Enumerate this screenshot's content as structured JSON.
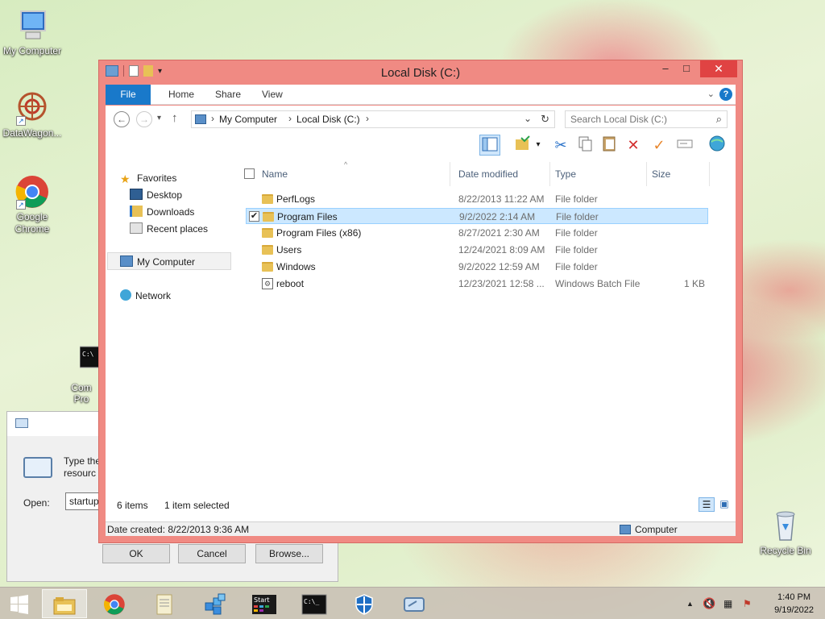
{
  "desktop": {
    "icons": [
      {
        "label": "My Computer"
      },
      {
        "label": "DataWagon..."
      },
      {
        "label": "Google Chrome"
      },
      {
        "label": "Com Pro"
      },
      {
        "label": "Recycle Bin"
      }
    ]
  },
  "run_dialog": {
    "description": "Type the\nresourc",
    "open_label": "Open:",
    "open_value": "startup",
    "ok_label": "OK",
    "cancel_label": "Cancel",
    "browse_label": "Browse..."
  },
  "explorer": {
    "title": "Local Disk (C:)",
    "minimize": "–",
    "maximize": "□",
    "close": "✕",
    "tabs": [
      "File",
      "Home",
      "Share",
      "View"
    ],
    "breadcrumb": [
      "My Computer",
      "Local Disk (C:)"
    ],
    "search_placeholder": "Search Local Disk (C:)",
    "nav": {
      "favorites": "Favorites",
      "favorites_items": [
        "Desktop",
        "Downloads",
        "Recent places"
      ],
      "my_computer": "My Computer",
      "network": "Network"
    },
    "columns": [
      "Name",
      "Date modified",
      "Type",
      "Size"
    ],
    "files": [
      {
        "name": "PerfLogs",
        "date": "8/22/2013 11:22 AM",
        "type": "File folder",
        "size": "",
        "kind": "folder",
        "selected": false
      },
      {
        "name": "Program Files",
        "date": "9/2/2022 2:14 AM",
        "type": "File folder",
        "size": "",
        "kind": "folder",
        "selected": true
      },
      {
        "name": "Program Files (x86)",
        "date": "8/27/2021 2:30 AM",
        "type": "File folder",
        "size": "",
        "kind": "folder",
        "selected": false
      },
      {
        "name": "Users",
        "date": "12/24/2021 8:09 AM",
        "type": "File folder",
        "size": "",
        "kind": "folder",
        "selected": false
      },
      {
        "name": "Windows",
        "date": "9/2/2022 12:59 AM",
        "type": "File folder",
        "size": "",
        "kind": "folder",
        "selected": false
      },
      {
        "name": "reboot",
        "date": "12/23/2021 12:58 ...",
        "type": "Windows Batch File",
        "size": "1 KB",
        "kind": "batch",
        "selected": false
      }
    ],
    "status": {
      "items": "6 items",
      "selected": "1 item selected"
    },
    "details": {
      "date_created": "Date created: 8/22/2013 9:36 AM",
      "location": "Computer"
    }
  },
  "taskbar": {
    "clock_time": "1:40 PM",
    "clock_date": "9/19/2022",
    "cmd_label": "Start"
  },
  "colors": {
    "accent": "#1979ca",
    "window_frame": "#f08a83",
    "close": "#e04343",
    "selection": "#cce8ff"
  }
}
